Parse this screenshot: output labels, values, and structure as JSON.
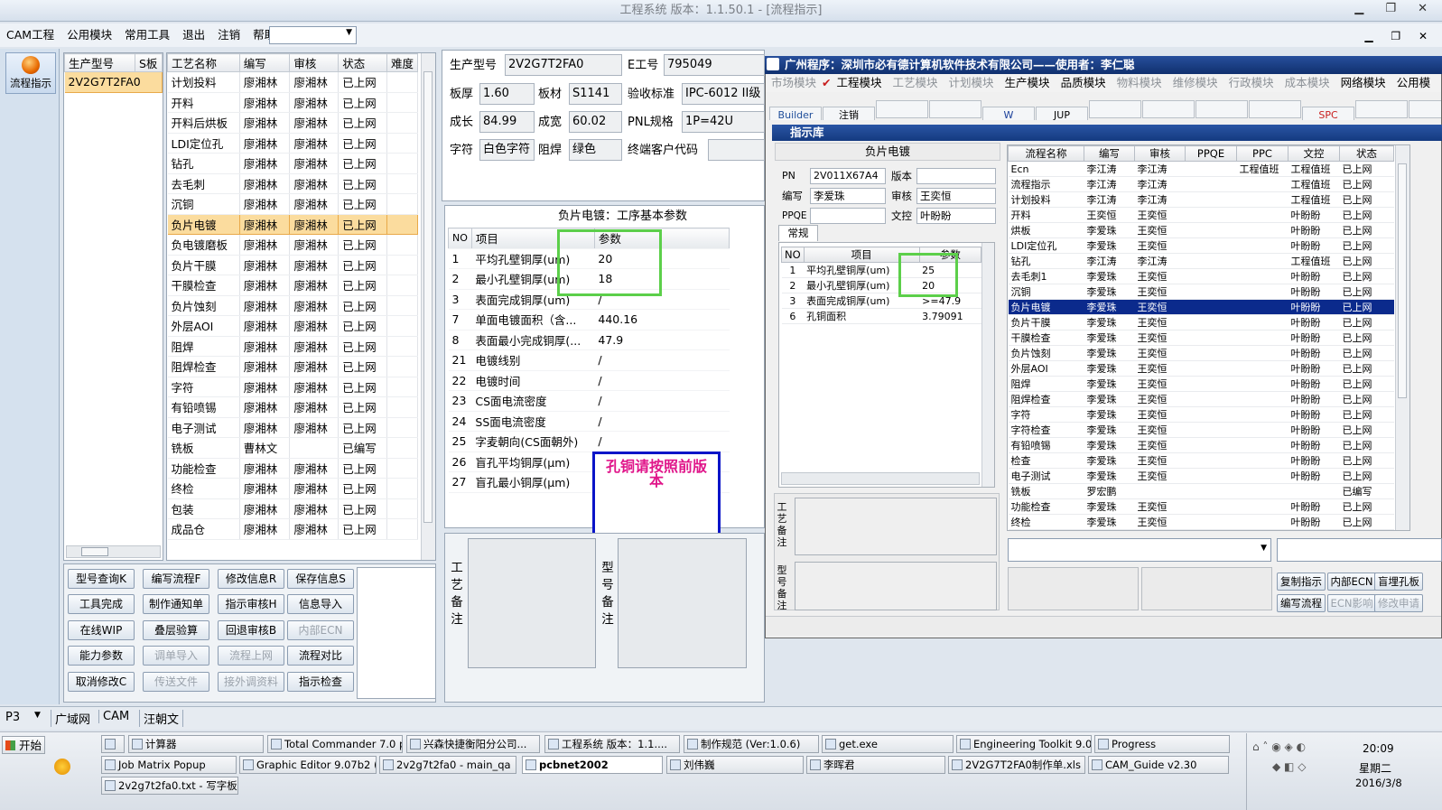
{
  "window": {
    "title": "工程系统   版本：1.1.50.1 - [流程指示]"
  },
  "menu": [
    "CAM工程",
    "公用模块",
    "常用工具",
    "退出",
    "注销",
    "帮助"
  ],
  "sidebar": {
    "label": "流程指示"
  },
  "model_list": {
    "headers": [
      "生产型号",
      "S板"
    ],
    "items": [
      "2V2G7T2FA0"
    ]
  },
  "process_table": {
    "headers": [
      "工艺名称",
      "编写",
      "审核",
      "状态",
      "难度"
    ],
    "rows": [
      [
        "计划投料",
        "廖湘林",
        "廖湘林",
        "已上网"
      ],
      [
        "开料",
        "廖湘林",
        "廖湘林",
        "已上网"
      ],
      [
        "开料后烘板",
        "廖湘林",
        "廖湘林",
        "已上网"
      ],
      [
        "LDI定位孔",
        "廖湘林",
        "廖湘林",
        "已上网"
      ],
      [
        "钻孔",
        "廖湘林",
        "廖湘林",
        "已上网"
      ],
      [
        "去毛刺",
        "廖湘林",
        "廖湘林",
        "已上网"
      ],
      [
        "沉铜",
        "廖湘林",
        "廖湘林",
        "已上网"
      ],
      [
        "负片电镀",
        "廖湘林",
        "廖湘林",
        "已上网"
      ],
      [
        "负电镀磨板",
        "廖湘林",
        "廖湘林",
        "已上网"
      ],
      [
        "负片干膜",
        "廖湘林",
        "廖湘林",
        "已上网"
      ],
      [
        "干膜检查",
        "廖湘林",
        "廖湘林",
        "已上网"
      ],
      [
        "负片蚀刻",
        "廖湘林",
        "廖湘林",
        "已上网"
      ],
      [
        "外层AOI",
        "廖湘林",
        "廖湘林",
        "已上网"
      ],
      [
        "阻焊",
        "廖湘林",
        "廖湘林",
        "已上网"
      ],
      [
        "阻焊检查",
        "廖湘林",
        "廖湘林",
        "已上网"
      ],
      [
        "字符",
        "廖湘林",
        "廖湘林",
        "已上网"
      ],
      [
        "有铅喷锡",
        "廖湘林",
        "廖湘林",
        "已上网"
      ],
      [
        "电子测试",
        "廖湘林",
        "廖湘林",
        "已上网"
      ],
      [
        "铣板",
        "曹林文",
        "",
        "已编写"
      ],
      [
        "功能检查",
        "廖湘林",
        "廖湘林",
        "已上网"
      ],
      [
        "终检",
        "廖湘林",
        "廖湘林",
        "已上网"
      ],
      [
        "包装",
        "廖湘林",
        "廖湘林",
        "已上网"
      ],
      [
        "成品仓",
        "廖湘林",
        "廖湘林",
        "已上网"
      ]
    ]
  },
  "buttons": [
    [
      "型号查询K",
      "编写流程F",
      "修改信息R",
      "保存信息S"
    ],
    [
      "工具完成",
      "制作通知单",
      "指示审核H",
      "信息导入"
    ],
    [
      "在线WIP",
      "叠层验算",
      "回退审核B",
      "内部ECN"
    ],
    [
      "能力参数",
      "调单导入",
      "流程上网",
      "流程对比"
    ],
    [
      "取消修改C",
      "传送文件",
      "接外调资料",
      "指示检查"
    ]
  ],
  "disabled_buttons": [
    "内部ECN",
    "调单导入",
    "流程上网",
    "传送文件",
    "接外调资料"
  ],
  "info": {
    "model_label": "生产型号",
    "model": "2V2G7T2FA0",
    "eno_label": "E工号",
    "eno": "795049",
    "thick_label": "板厚",
    "thick": "1.60",
    "mat_label": "板材",
    "mat": "S1141",
    "std_label": "验收标准",
    "std": "IPC-6012 II级",
    "len_label": "成长",
    "len": "84.99",
    "wid_label": "成宽",
    "wid": "60.02",
    "pnl_label": "PNL规格",
    "pnl": "1P=42U",
    "char_label": "字符",
    "char": "白色字符",
    "mask_label": "阻焊",
    "mask": "绿色",
    "cust_label": "终端客户代码"
  },
  "params": {
    "title": "负片电镀：工序基本参数",
    "headers": [
      "NO",
      "项目",
      "参数"
    ],
    "rows": [
      [
        "1",
        "平均孔壁铜厚(um)",
        "20"
      ],
      [
        "2",
        "最小孔壁铜厚(um)",
        "18"
      ],
      [
        "3",
        "表面完成铜厚(um)",
        "/"
      ],
      [
        "7",
        "单面电镀面积（含...",
        "440.16"
      ],
      [
        "8",
        "表面最小完成铜厚(...",
        "47.9"
      ],
      [
        "21",
        "电镀线别",
        "/"
      ],
      [
        "22",
        "电镀时间",
        "/"
      ],
      [
        "23",
        "CS面电流密度",
        "/"
      ],
      [
        "24",
        "SS面电流密度",
        "/"
      ],
      [
        "25",
        "字麦朝向(CS面朝外)",
        "/"
      ],
      [
        "26",
        "盲孔平均铜厚(μm)",
        "/"
      ],
      [
        "27",
        "盲孔最小铜厚(μm)",
        "/"
      ]
    ]
  },
  "note": "孔铜请按照前版本",
  "remark_labels": {
    "process": "工艺备注",
    "model": "型号备注"
  },
  "status_tabs": [
    "P3",
    "广域网",
    "CAM",
    "汪朝文"
  ],
  "popup": {
    "title": "广州程序：深圳市必有德计算机软件技术有限公司——使用者：李仁聪",
    "menu": [
      "市场模块",
      "工程模块",
      "工艺模块",
      "计划模块",
      "生产模块",
      "品质模块",
      "物料模块",
      "维修模块",
      "行政模块",
      "成本模块",
      "网络模块",
      "公用模"
    ],
    "active_menu": [
      "工程模块",
      "生产模块",
      "品质模块",
      "网络模块",
      "公用模"
    ],
    "toolbar": [
      "Builder",
      "注销",
      "",
      "",
      "W",
      "JUP",
      "",
      "",
      "",
      "",
      "SPC",
      "",
      ""
    ],
    "sub_title": "指示库",
    "section": "负片电镀",
    "pn_label": "PN",
    "pn": "2V011X67A4",
    "ver_label": "版本",
    "ver": "",
    "author_label": "编写",
    "author": "李爱珠",
    "rev_label": "审核",
    "rev": "王奕恒",
    "ppqe_label": "PPQE",
    "ppqe": "",
    "doc_label": "文控",
    "doc": "叶盼盼",
    "tab": "常规",
    "param_headers": [
      "NO",
      "项目",
      "参数"
    ],
    "params": [
      [
        "1",
        "平均孔壁铜厚(um)",
        "25"
      ],
      [
        "2",
        "最小孔壁铜厚(um)",
        "20"
      ],
      [
        "3",
        "表面完成铜厚(um)",
        ">=47.9"
      ],
      [
        "6",
        "孔铜面积",
        "3.79091"
      ]
    ],
    "flow_headers": [
      "流程名称",
      "编写",
      "审核",
      "PPQE",
      "PPC",
      "文控",
      "状态"
    ],
    "flows": [
      [
        "Ecn",
        "李江涛",
        "李江涛",
        "",
        "工程值班",
        "工程值班",
        "已上网"
      ],
      [
        "流程指示",
        "李江涛",
        "李江涛",
        "",
        "",
        "工程值班",
        "已上网"
      ],
      [
        "计划投料",
        "李江涛",
        "李江涛",
        "",
        "",
        "工程值班",
        "已上网"
      ],
      [
        "开料",
        "王奕恒",
        "王奕恒",
        "",
        "",
        "叶盼盼",
        "已上网"
      ],
      [
        "烘板",
        "李爱珠",
        "王奕恒",
        "",
        "",
        "叶盼盼",
        "已上网"
      ],
      [
        "LDI定位孔",
        "李爱珠",
        "王奕恒",
        "",
        "",
        "叶盼盼",
        "已上网"
      ],
      [
        "钻孔",
        "李江涛",
        "李江涛",
        "",
        "",
        "工程值班",
        "已上网"
      ],
      [
        "去毛刺1",
        "李爱珠",
        "王奕恒",
        "",
        "",
        "叶盼盼",
        "已上网"
      ],
      [
        "沉铜",
        "李爱珠",
        "王奕恒",
        "",
        "",
        "叶盼盼",
        "已上网"
      ],
      [
        "负片电镀",
        "李爱珠",
        "王奕恒",
        "",
        "",
        "叶盼盼",
        "已上网"
      ],
      [
        "负片干膜",
        "李爱珠",
        "王奕恒",
        "",
        "",
        "叶盼盼",
        "已上网"
      ],
      [
        "干膜检查",
        "李爱珠",
        "王奕恒",
        "",
        "",
        "叶盼盼",
        "已上网"
      ],
      [
        "负片蚀刻",
        "李爱珠",
        "王奕恒",
        "",
        "",
        "叶盼盼",
        "已上网"
      ],
      [
        "外层AOI",
        "李爱珠",
        "王奕恒",
        "",
        "",
        "叶盼盼",
        "已上网"
      ],
      [
        "阻焊",
        "李爱珠",
        "王奕恒",
        "",
        "",
        "叶盼盼",
        "已上网"
      ],
      [
        "阻焊检查",
        "李爱珠",
        "王奕恒",
        "",
        "",
        "叶盼盼",
        "已上网"
      ],
      [
        "字符",
        "李爱珠",
        "王奕恒",
        "",
        "",
        "叶盼盼",
        "已上网"
      ],
      [
        "字符检查",
        "李爱珠",
        "王奕恒",
        "",
        "",
        "叶盼盼",
        "已上网"
      ],
      [
        "有铅喷锡",
        "李爱珠",
        "王奕恒",
        "",
        "",
        "叶盼盼",
        "已上网"
      ],
      [
        "检查",
        "李爱珠",
        "王奕恒",
        "",
        "",
        "叶盼盼",
        "已上网"
      ],
      [
        "电子测试",
        "李爱珠",
        "王奕恒",
        "",
        "",
        "叶盼盼",
        "已上网"
      ],
      [
        "铣板",
        "罗宏鹏",
        "",
        "",
        "",
        "",
        "已编写"
      ],
      [
        "功能检查",
        "李爱珠",
        "王奕恒",
        "",
        "",
        "叶盼盼",
        "已上网"
      ],
      [
        "终检",
        "李爱珠",
        "王奕恒",
        "",
        "",
        "叶盼盼",
        "已上网"
      ]
    ],
    "remark_labels": {
      "process": "工艺备注",
      "model": "型号备注"
    },
    "bottom_buttons": [
      "复制指示",
      "内部ECN",
      "盲埋孔板",
      "编写流程",
      "ECN影响",
      "修改申请"
    ]
  },
  "taskbar": {
    "start": "开始",
    "row1": [
      "",
      "计算器",
      "Total Commander 7.0 p...",
      "兴森快捷衡阳分公司...",
      "工程系统  版本：1.1....",
      "制作规范 (Ver:1.0.6)",
      "get.exe",
      "Engineering Toolkit 9.0...",
      "Progress"
    ],
    "row2": [
      "Job Matrix Popup",
      "Graphic Editor 9.07b2 (0...",
      "2v2g7t2fa0 - main_qa",
      "pcbnet2002",
      "刘伟巍",
      "李晖君",
      "2V2G7T2FA0制作单.xls ...",
      "CAM_Guide v2.30"
    ],
    "row3": [
      "2v2g7t2fa0.txt - 写字板"
    ],
    "time": "20:09",
    "weekday": "星期二",
    "date": "2016/3/8"
  },
  "colors": {
    "selected_row": "#fbdc9e",
    "popup_title": "#10306e",
    "popup_selected": "#0b2a8c",
    "note_text": "#e0168a",
    "note_border": "#0a14c8",
    "highlight": "#5ccf4a"
  }
}
